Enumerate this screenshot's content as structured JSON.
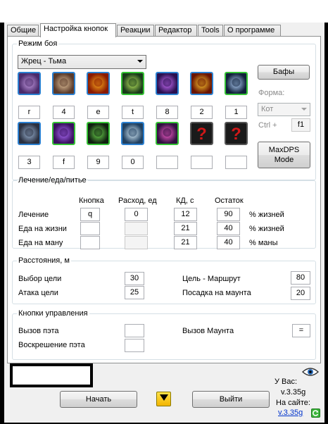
{
  "tabs": [
    {
      "label": "Общие",
      "active": false
    },
    {
      "label": "Настройка кнопок",
      "active": true
    },
    {
      "label": "Реакции",
      "active": false
    },
    {
      "label": "Редактор",
      "active": false
    },
    {
      "label": "Tools",
      "active": false
    },
    {
      "label": "О программе",
      "active": false
    }
  ],
  "combat": {
    "legend": "Режим боя",
    "spec": "Жрец - Тьма",
    "buffs_button": "Бафы",
    "form_label": "Форма:",
    "form_value": "Кот",
    "ctrl_label": "Ctrl +",
    "ctrl_value": "f1",
    "maxdps_button": "MaxDPS\nMode",
    "row1_keys": [
      "r",
      "4",
      "e",
      "t",
      "8",
      "2",
      "1"
    ],
    "row2_keys": [
      "3",
      "f",
      "9",
      "0",
      "",
      "",
      ""
    ],
    "row1_icons": [
      "skull-purple-icon",
      "swirl-icon",
      "flame-skull-icon",
      "green-skull-icon",
      "purple-shard-icon",
      "fire-skull-icon",
      "hand-icon"
    ],
    "row2_icons": [
      "warrior-icon",
      "void-icon",
      "dark-figure-icon",
      "crystal-icon",
      "shadow-orb-icon",
      "question-mark-icon",
      "question-mark-icon"
    ]
  },
  "heal": {
    "legend": "Лечение/еда/питье",
    "col_key": "Кнопка",
    "col_cost": "Расход, ед",
    "col_cd": "КД, с",
    "col_rest": "Остаток",
    "rows": [
      {
        "label": "Лечение",
        "key": "q",
        "cost": "0",
        "cd": "12",
        "rest": "90",
        "unit": "% жизней"
      },
      {
        "label": "Еда на жизни",
        "key": "",
        "cost": "",
        "cd": "21",
        "rest": "40",
        "unit": "% жизней"
      },
      {
        "label": "Еда на ману",
        "key": "",
        "cost": "",
        "cd": "21",
        "rest": "40",
        "unit": "% маны"
      }
    ]
  },
  "distance": {
    "legend": "Расстояния, м",
    "target_select": "Выбор цели",
    "target_select_val": "30",
    "target_attack": "Атака цели",
    "target_attack_val": "25",
    "target_route": "Цель - Маршрут",
    "target_route_val": "80",
    "mount_land": "Посадка на маунта",
    "mount_land_val": "20"
  },
  "controls": {
    "legend": "Кнопки управления",
    "call_pet": "Вызов пэта",
    "call_pet_val": "",
    "revive_pet": "Воскрешение пэта",
    "revive_pet_val": "",
    "call_mount": "Вызов Маунта",
    "call_mount_val": "="
  },
  "bottom": {
    "start": "Начать",
    "exit": "Выйти",
    "you_have": "У Вас:",
    "your_version": "v.3.35g",
    "on_site": "На сайте:",
    "site_version": "v.3.35g"
  }
}
